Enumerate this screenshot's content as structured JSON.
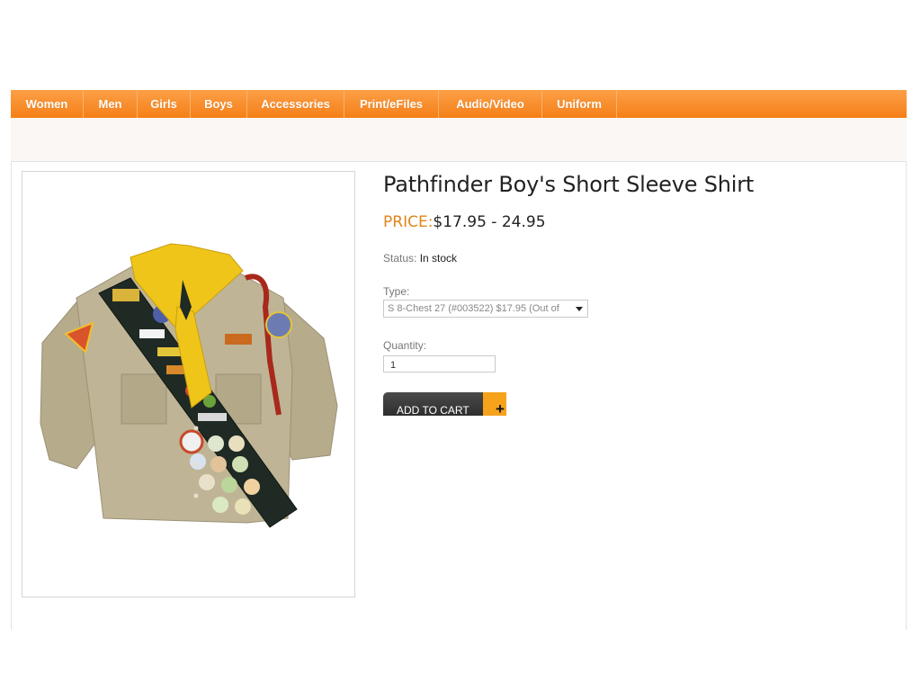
{
  "nav": {
    "items": [
      {
        "label": "Women"
      },
      {
        "label": "Men"
      },
      {
        "label": "Girls"
      },
      {
        "label": "Boys"
      },
      {
        "label": "Accessories"
      },
      {
        "label": "Print/eFiles"
      },
      {
        "label": "Audio/Video"
      },
      {
        "label": "Uniform"
      }
    ]
  },
  "product": {
    "title": "Pathfinder Boy's Short Sleeve Shirt",
    "price_label": "PRICE:",
    "price_value": "$17.95 - 24.95",
    "status_label": "Status:",
    "status_value": "In stock",
    "type_label": "Type:",
    "type_selected": "S 8-Chest 27 (#003522) $17.95 (Out of",
    "quantity_label": "Quantity:",
    "quantity_value": "1",
    "add_to_cart_label": "ADD TO CART",
    "add_to_cart_plus": "+"
  },
  "icons": {
    "product_image": "pathfinder-shirt-photo",
    "dropdown": "chevron-down-icon",
    "add": "plus-icon"
  },
  "colors": {
    "nav_orange": "#f57f17",
    "price_label": "#e0861a",
    "cart_button": "#333333",
    "cart_plus": "#f6a21b"
  }
}
